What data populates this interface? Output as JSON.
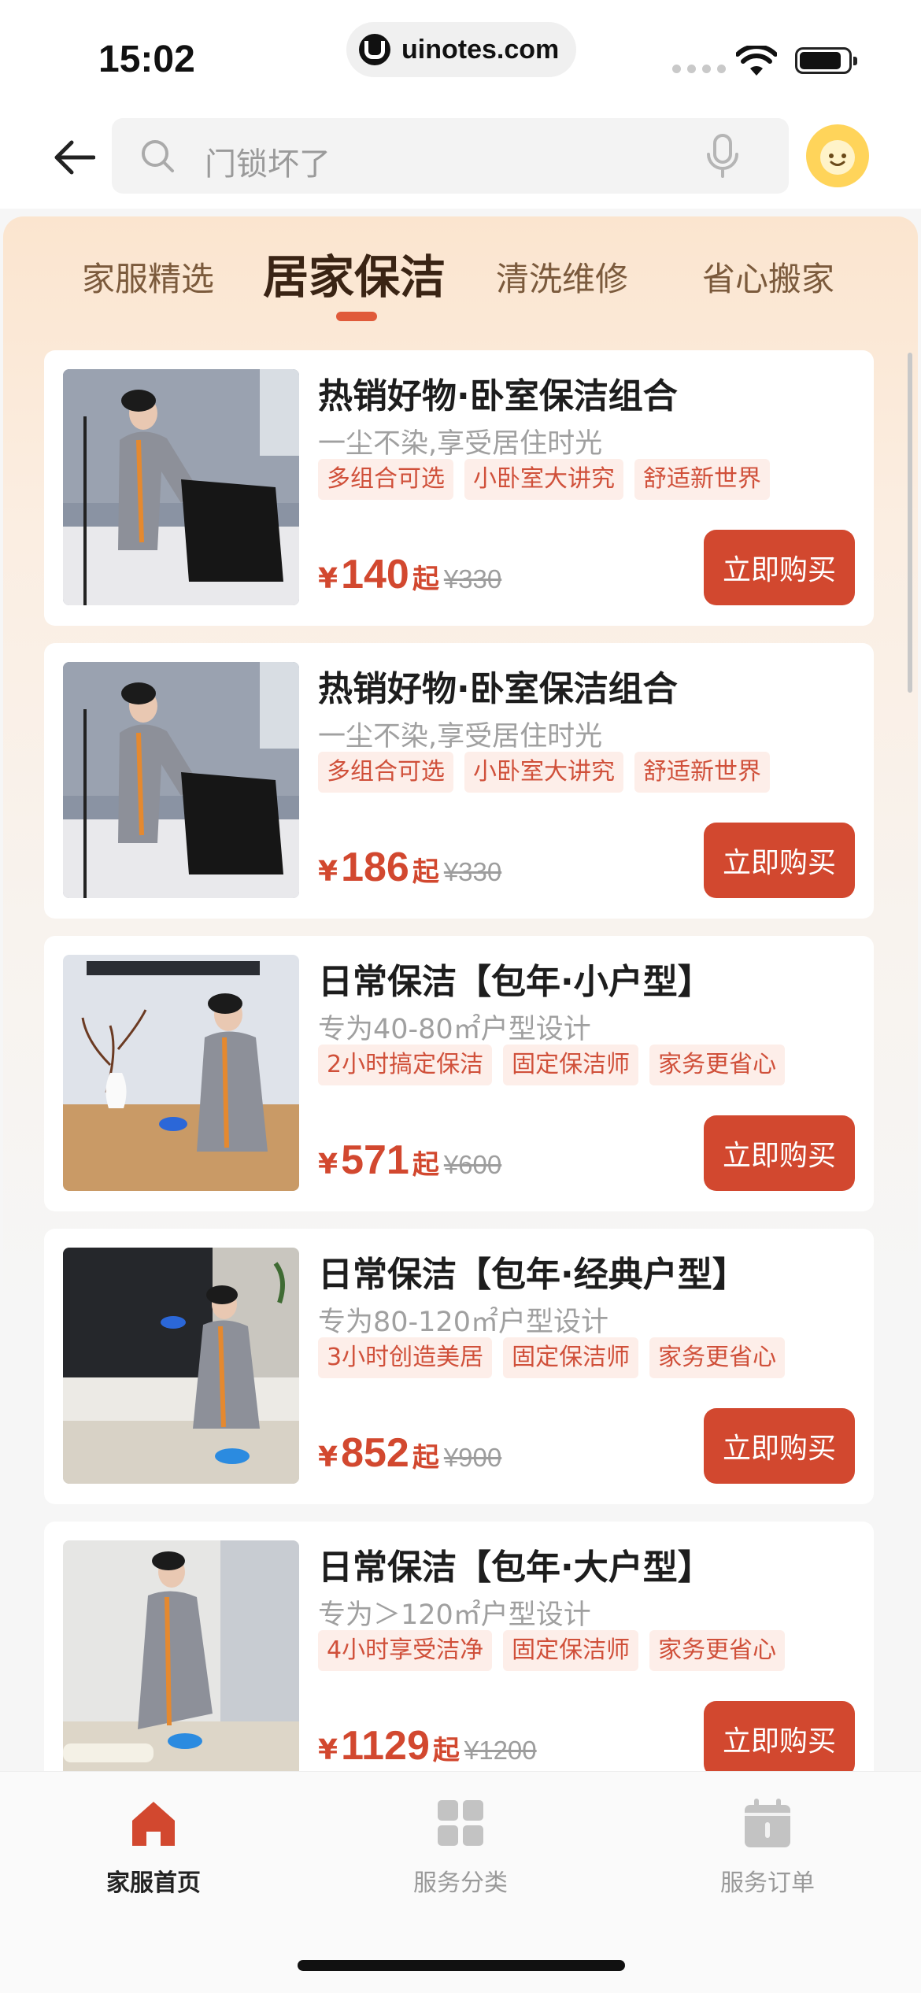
{
  "status_bar": {
    "time": "15:02",
    "url": "uinotes.com"
  },
  "search": {
    "placeholder": "门锁坏了"
  },
  "category_tabs": [
    {
      "label": "家服精选",
      "active": false
    },
    {
      "label": "居家保洁",
      "active": true
    },
    {
      "label": "清洗维修",
      "active": false
    },
    {
      "label": "省心搬家",
      "active": false
    }
  ],
  "colors": {
    "accent": "#d2482f",
    "tag_bg": "#fdeee9",
    "tab_text": "#7b5a3c"
  },
  "products": [
    {
      "title": "热销好物·卧室保洁组合",
      "subtitle": "一尘不染,享受居住时光",
      "tags": [
        "多组合可选",
        "小卧室大讲究",
        "舒适新世界"
      ],
      "currency": "¥",
      "price": "140",
      "suffix": "起",
      "original_price": "¥330",
      "button": "立即购买"
    },
    {
      "title": "热销好物·卧室保洁组合",
      "subtitle": "一尘不染,享受居住时光",
      "tags": [
        "多组合可选",
        "小卧室大讲究",
        "舒适新世界"
      ],
      "currency": "¥",
      "price": "186",
      "suffix": "起",
      "original_price": "¥330",
      "button": "立即购买"
    },
    {
      "title": "日常保洁【包年·小户型】",
      "subtitle": "专为40-80㎡户型设计",
      "tags": [
        "2小时搞定保洁",
        "固定保洁师",
        "家务更省心"
      ],
      "currency": "¥",
      "price": "571",
      "suffix": "起",
      "original_price": "¥600",
      "button": "立即购买"
    },
    {
      "title": "日常保洁【包年·经典户型】",
      "subtitle": "专为80-120㎡户型设计",
      "tags": [
        "3小时创造美居",
        "固定保洁师",
        "家务更省心"
      ],
      "currency": "¥",
      "price": "852",
      "suffix": "起",
      "original_price": "¥900",
      "button": "立即购买"
    },
    {
      "title": "日常保洁【包年·大户型】",
      "subtitle": "专为＞120㎡户型设计",
      "tags": [
        "4小时享受洁净",
        "固定保洁师",
        "家务更省心"
      ],
      "currency": "¥",
      "price": "1129",
      "suffix": "起",
      "original_price": "¥1200",
      "button": "立即购买"
    }
  ],
  "tabbar": [
    {
      "label": "家服首页",
      "icon": "home-icon",
      "active": true
    },
    {
      "label": "服务分类",
      "icon": "grid-icon",
      "active": false
    },
    {
      "label": "服务订单",
      "icon": "calendar-icon",
      "active": false
    }
  ]
}
